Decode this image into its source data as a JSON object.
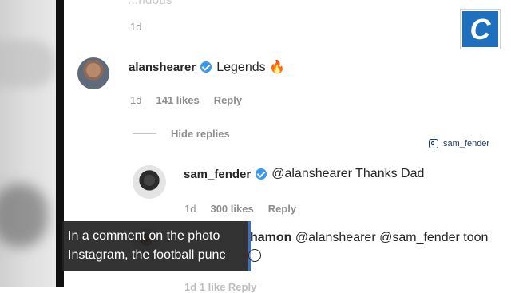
{
  "top": {
    "faded_comment": "...ndous",
    "time": "1d"
  },
  "comments": [
    {
      "username": "alanshearer",
      "text": "Legends 🔥",
      "time": "1d",
      "likes": "141 likes",
      "reply": "Reply"
    }
  ],
  "hide_replies": "Hide replies",
  "replies": [
    {
      "username": "sam_fender",
      "text": "@alanshearer Thanks Dad",
      "time": "1d",
      "likes": "300 likes",
      "reply": "Reply"
    },
    {
      "username_partial": "hamon",
      "text": "@alanshearer @sam_fender toon"
    }
  ],
  "ig_tag": "sam_fender",
  "logo_letter": "C",
  "caption": {
    "line1": "In a comment on the photo",
    "line2": "Instagram, the football punc"
  },
  "bottom_faded": "1d   1 like   Reply",
  "colors": {
    "verified": "#3897f0",
    "logo_bg": "#1f6fbf",
    "caption_bg": "#222222"
  }
}
